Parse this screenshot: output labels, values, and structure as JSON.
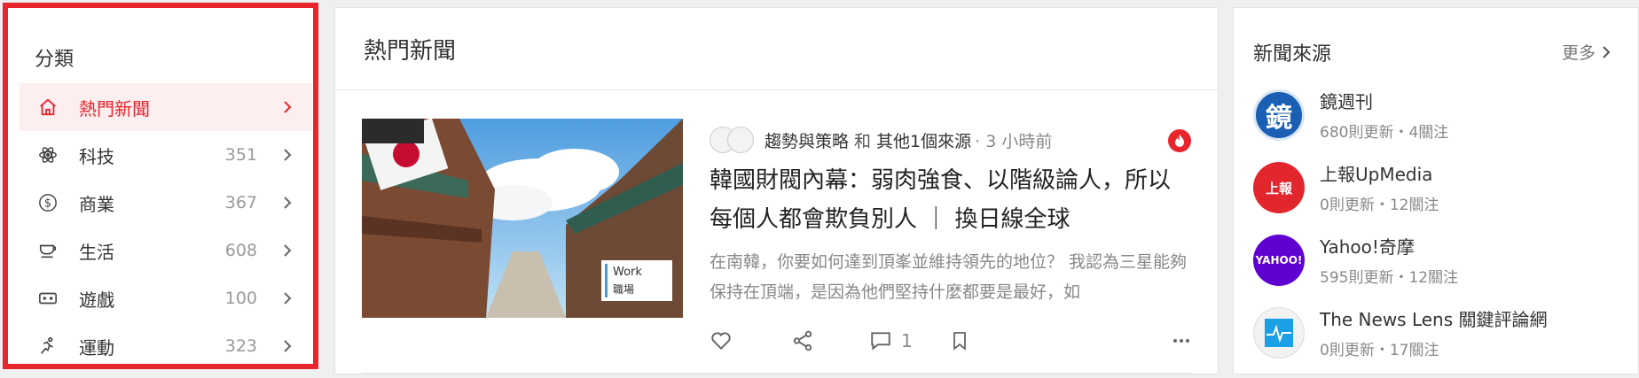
{
  "categories": {
    "title": "分類",
    "items": [
      {
        "label": "熱門新聞",
        "count": "",
        "active": true,
        "icon": "home-icon"
      },
      {
        "label": "科技",
        "count": "351",
        "icon": "atom-icon"
      },
      {
        "label": "商業",
        "count": "367",
        "icon": "dollar-icon"
      },
      {
        "label": "生活",
        "count": "608",
        "icon": "cup-icon"
      },
      {
        "label": "遊戲",
        "count": "100",
        "icon": "gamepad-icon"
      },
      {
        "label": "運動",
        "count": "323",
        "icon": "runner-icon"
      }
    ]
  },
  "main": {
    "title": "熱門新聞",
    "article": {
      "source_primary": "趨勢與策略",
      "source_joiner": "和",
      "source_secondary": "其他1個來源",
      "time": "· 3 小時前",
      "title": "韓國財閥內幕：弱肉強食、以階級論人，所以每個人都會欺負別人 ｜ 換日線全球",
      "description": "在南韓，你要如何達到頂峯並維持領先的地位？ 我認為三星能夠保持在頂端，是因為他們堅持什麼都要是最好，如",
      "thumb_badge_line1": "Work",
      "thumb_badge_line2": "職場",
      "comment_count": "1"
    }
  },
  "sources": {
    "title": "新聞來源",
    "more_label": "更多",
    "items": [
      {
        "name": "鏡週刊",
        "stats": "680則更新・4關注",
        "logo_text": "鏡"
      },
      {
        "name": "上報UpMedia",
        "stats": "0則更新・12關注",
        "logo_text": "上報"
      },
      {
        "name": "Yahoo!奇摩",
        "stats": "595則更新・12關注",
        "logo_text": "YAHOO!"
      },
      {
        "name": "The News Lens 關鍵評論網",
        "stats": "0則更新・17關注",
        "logo_text": ""
      }
    ]
  },
  "colors": {
    "accent": "#e8242d",
    "active_bg": "#fdeff0"
  }
}
